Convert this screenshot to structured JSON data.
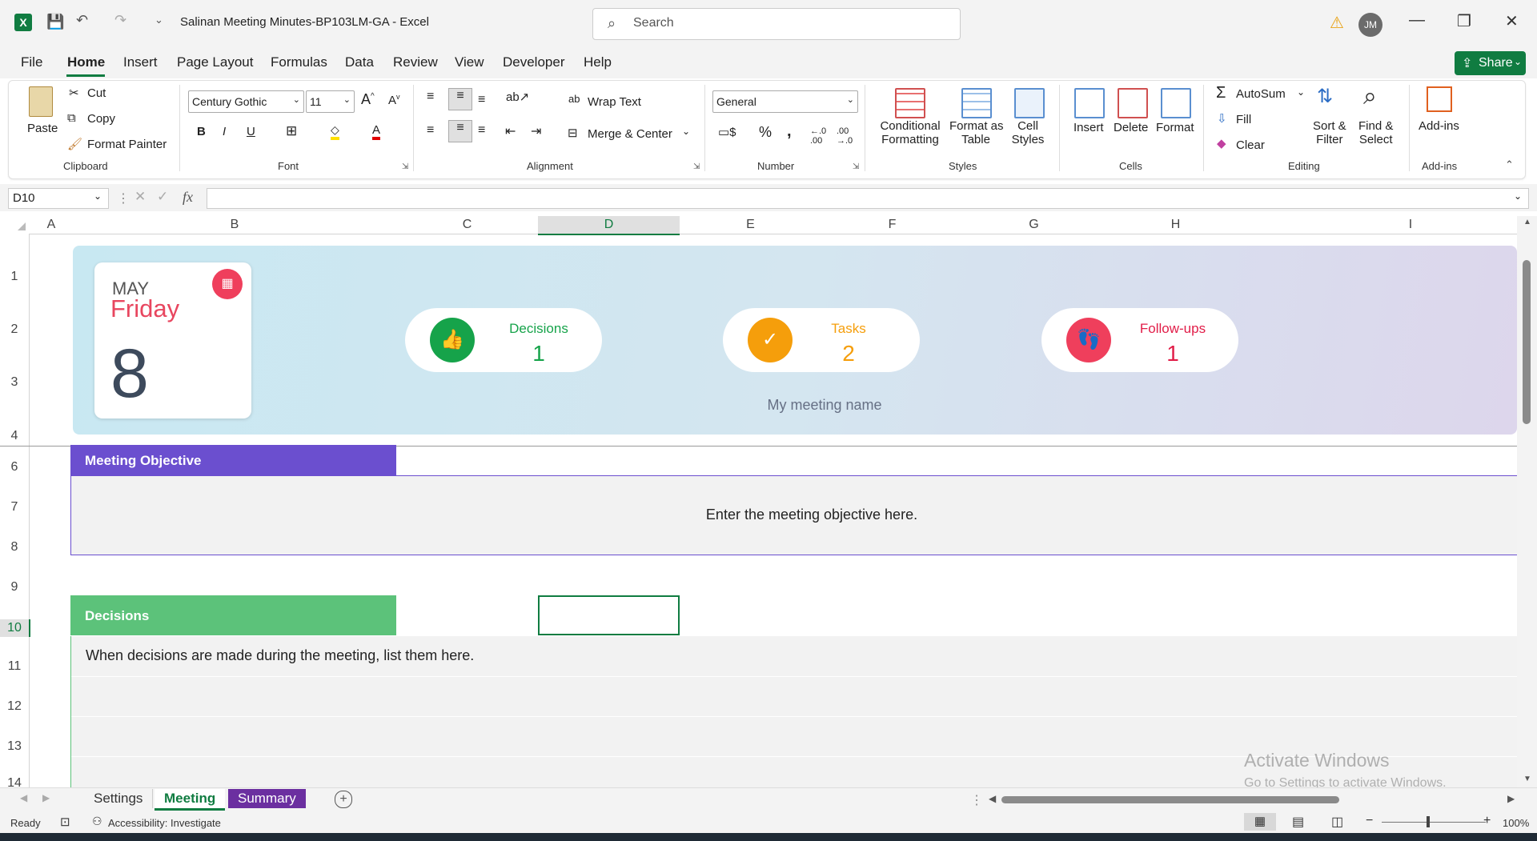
{
  "window": {
    "title": "Salinan Meeting Minutes-BP103LM-GA  -  Excel",
    "search_placeholder": "Search",
    "user_initials": "JM",
    "share_label": "Share"
  },
  "menu": {
    "tabs": [
      "File",
      "Home",
      "Insert",
      "Page Layout",
      "Formulas",
      "Data",
      "Review",
      "View",
      "Developer",
      "Help"
    ]
  },
  "ribbon": {
    "clipboard": {
      "group": "Clipboard",
      "paste": "Paste",
      "cut": "Cut",
      "copy": "Copy",
      "format_painter": "Format Painter"
    },
    "font": {
      "group": "Font",
      "name": "Century Gothic",
      "size": "11"
    },
    "alignment": {
      "group": "Alignment",
      "wrap_text": "Wrap Text",
      "merge_center": "Merge & Center"
    },
    "number": {
      "group": "Number",
      "format": "General"
    },
    "styles": {
      "group": "Styles",
      "conditional_1": "Conditional",
      "conditional_2": "Formatting",
      "format_table_1": "Format as",
      "format_table_2": "Table",
      "cell_styles_1": "Cell",
      "cell_styles_2": "Styles"
    },
    "cells": {
      "group": "Cells",
      "insert": "Insert",
      "delete": "Delete",
      "format": "Format"
    },
    "editing": {
      "group": "Editing",
      "autosum": "AutoSum",
      "fill": "Fill",
      "clear": "Clear",
      "sort_1": "Sort &",
      "sort_2": "Filter",
      "find_1": "Find &",
      "find_2": "Select"
    },
    "addins": {
      "group": "Add-ins",
      "label": "Add-ins"
    }
  },
  "formula_bar": {
    "name_box": "D10",
    "fx": "fx",
    "content": ""
  },
  "columns": [
    "A",
    "B",
    "C",
    "D",
    "E",
    "F",
    "G",
    "H",
    "I"
  ],
  "rows": [
    "1",
    "2",
    "3",
    "4",
    "6",
    "7",
    "8",
    "9",
    "10",
    "11",
    "12",
    "13",
    "14"
  ],
  "banner": {
    "month": "MAY",
    "weekday": "Friday",
    "day": "8",
    "meeting_name": "My meeting name",
    "kpis": [
      {
        "label": "Decisions",
        "value": "1",
        "color": "#16a34a"
      },
      {
        "label": "Tasks",
        "value": "2",
        "color": "#f59e0b"
      },
      {
        "label": "Follow-ups",
        "value": "1",
        "color": "#ef3f5c"
      }
    ]
  },
  "sections": {
    "objective": {
      "title": "Meeting Objective",
      "body": "Enter the meeting objective here.",
      "color": "#6b4fcf"
    },
    "decisions": {
      "title": "Decisions",
      "body": "When decisions are made during the meeting, list them here.",
      "color": "#5cc27a"
    }
  },
  "watermark": {
    "line1": "Activate Windows",
    "line2": "Go to Settings to activate Windows."
  },
  "sheet_tabs": [
    {
      "label": "Settings",
      "active": false
    },
    {
      "label": "Meeting",
      "active": true
    },
    {
      "label": "Summary",
      "active": false
    }
  ],
  "status": {
    "ready": "Ready",
    "accessibility": "Accessibility: Investigate",
    "zoom": "100%"
  }
}
